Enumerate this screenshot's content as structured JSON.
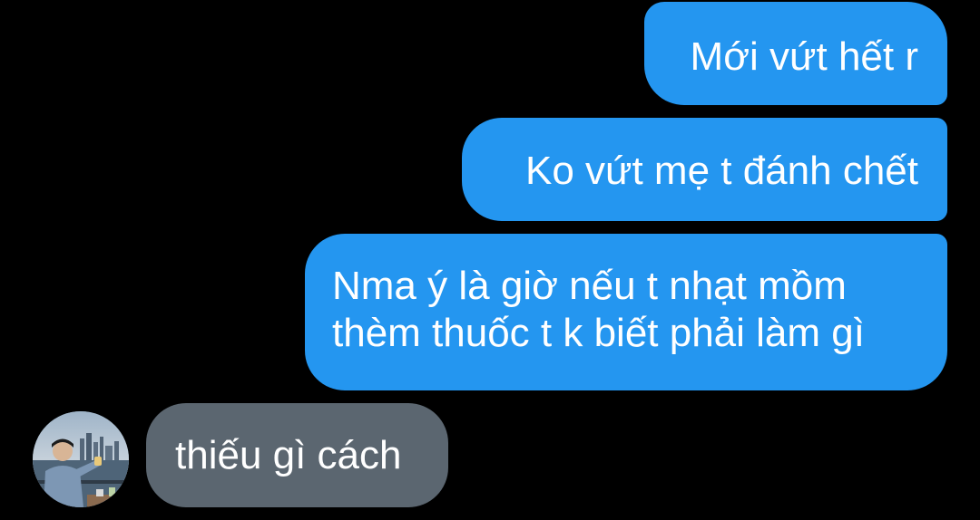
{
  "messages": [
    {
      "direction": "outgoing",
      "text": "Mới vứt hết r"
    },
    {
      "direction": "outgoing",
      "text": "Ko vứt mẹ t đánh chết"
    },
    {
      "direction": "outgoing",
      "lines": [
        "Nma ý là giờ nếu t nhạt mồm",
        "thèm thuốc t k biết phải làm gì"
      ]
    },
    {
      "direction": "incoming",
      "text": "thiếu gì cách"
    }
  ],
  "colors": {
    "background": "#000000",
    "outgoing_bubble": "#2496f0",
    "incoming_bubble": "#5b6670",
    "text": "#ffffff"
  },
  "avatar": {
    "icon": "contact-avatar-photo"
  }
}
